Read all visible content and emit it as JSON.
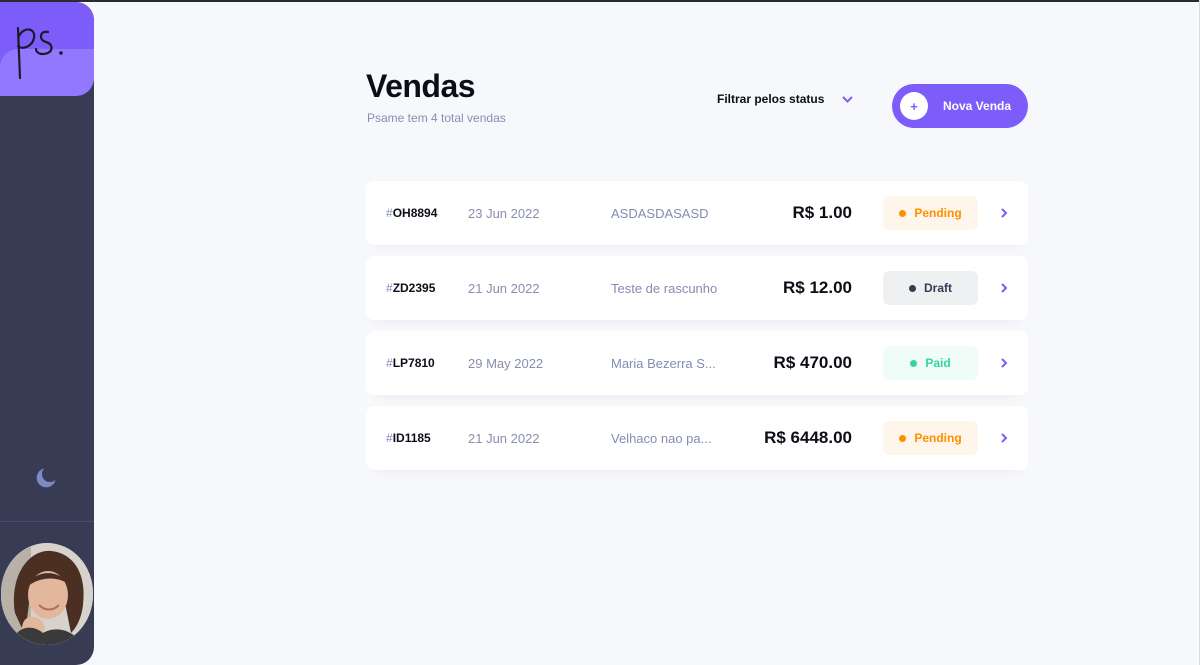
{
  "brand": {
    "logo_text": "ps."
  },
  "header": {
    "title": "Vendas",
    "subtitle": "Psame tem 4 total vendas",
    "filter_label": "Filtrar pelos status",
    "new_button_label": "Nova Venda",
    "new_button_icon": "+"
  },
  "colors": {
    "accent": "#7c5dfa",
    "sidebar": "#373b53",
    "pending": "#ff8f00",
    "paid": "#33d69f",
    "draft": "#373b53"
  },
  "invoices": [
    {
      "hash": "#",
      "id": "OH8894",
      "date": "23 Jun 2022",
      "client": "ASDASDASASD",
      "amount": "R$ 1.00",
      "status": "Pending"
    },
    {
      "hash": "#",
      "id": "ZD2395",
      "date": "21 Jun 2022",
      "client": "Teste de rascunho",
      "amount": "R$ 12.00",
      "status": "Draft"
    },
    {
      "hash": "#",
      "id": "LP7810",
      "date": "29 May 2022",
      "client": "Maria Bezerra S...",
      "amount": "R$ 470.00",
      "status": "Paid"
    },
    {
      "hash": "#",
      "id": "ID1185",
      "date": "21 Jun 2022",
      "client": "Velhaco nao pa...",
      "amount": "R$ 6448.00",
      "status": "Pending"
    }
  ]
}
